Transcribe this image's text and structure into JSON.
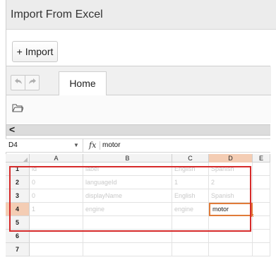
{
  "window": {
    "title": "Import From Excel"
  },
  "toolbar": {
    "import_label": "+ Import"
  },
  "ribbon": {
    "tabs": [
      {
        "label": "Home"
      }
    ]
  },
  "formula_bar": {
    "cell_ref": "D4",
    "fx_label": "fx",
    "value": "motor"
  },
  "sheet": {
    "columns": [
      "A",
      "B",
      "C",
      "D",
      "E"
    ],
    "active_column": "D",
    "row_numbers": [
      "1",
      "2",
      "3",
      "4",
      "5",
      "6",
      "7"
    ],
    "active_row": "4",
    "rows": [
      [
        "id",
        "label",
        "English",
        "Spanish",
        ""
      ],
      [
        "0",
        "languageId",
        "1",
        "2",
        ""
      ],
      [
        "0",
        "displayName",
        "English",
        "Spanish",
        ""
      ],
      [
        "1",
        "engine",
        "engine",
        "motor",
        ""
      ],
      [
        "",
        "",
        "",
        "",
        ""
      ],
      [
        "",
        "",
        "",
        "",
        ""
      ],
      [
        "",
        "",
        "",
        "",
        ""
      ]
    ]
  },
  "colors": {
    "selection": "#e07b39",
    "highlight": "#d62a2a",
    "active_header": "#f4cdb4"
  }
}
